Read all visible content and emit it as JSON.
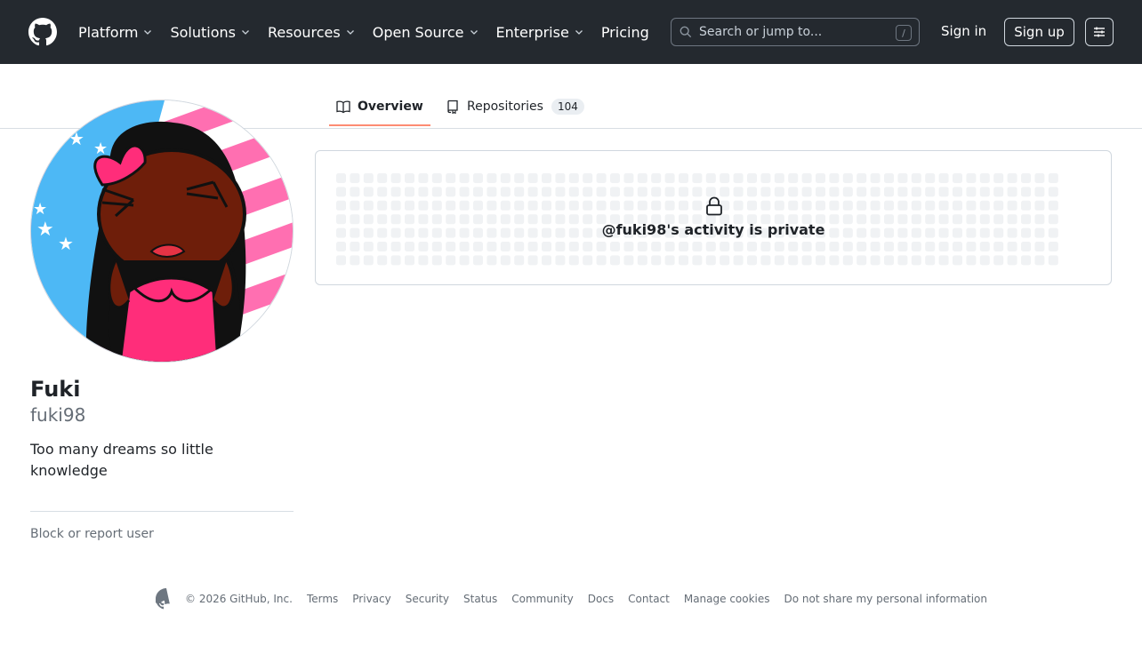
{
  "header": {
    "nav": [
      {
        "label": "Platform",
        "dropdown": true
      },
      {
        "label": "Solutions",
        "dropdown": true
      },
      {
        "label": "Resources",
        "dropdown": true
      },
      {
        "label": "Open Source",
        "dropdown": true
      },
      {
        "label": "Enterprise",
        "dropdown": true
      },
      {
        "label": "Pricing",
        "dropdown": false
      }
    ],
    "search_placeholder": "Search or jump to...",
    "search_shortcut": "/",
    "signin": "Sign in",
    "signup": "Sign up"
  },
  "tabs": {
    "overview": "Overview",
    "repositories": "Repositories",
    "repositories_count": "104"
  },
  "profile": {
    "display_name": "Fuki",
    "username": "fuki98",
    "bio": "Too many dreams so little knowledge",
    "block_link": "Block or report user"
  },
  "activity": {
    "private_text": "@fuki98's activity is private"
  },
  "footer": {
    "copyright": "© 2026 GitHub, Inc.",
    "links": [
      "Terms",
      "Privacy",
      "Security",
      "Status",
      "Community",
      "Docs",
      "Contact",
      "Manage cookies",
      "Do not share my personal information"
    ]
  },
  "colors": {
    "header_bg": "#24292f",
    "tab_underline": "#fd8c73",
    "muted_text": "#656d76"
  },
  "icons": [
    "github-mark-icon",
    "chevron-down-icon",
    "search-icon",
    "menu-icon",
    "book-icon",
    "repo-icon",
    "lock-icon"
  ]
}
